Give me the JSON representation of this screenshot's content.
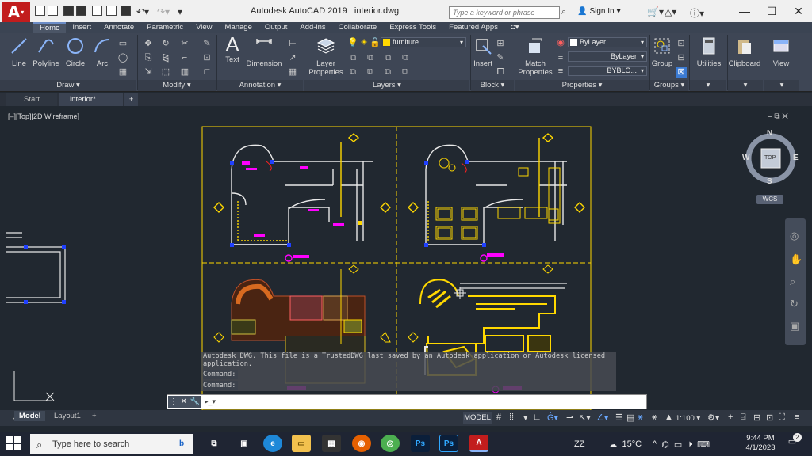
{
  "titlebar": {
    "app_name": "Autodesk AutoCAD 2019",
    "file_name": "interior.dwg",
    "search_placeholder": "Type a keyword or phrase",
    "sign_in": "Sign In",
    "logo_letter": "A"
  },
  "ribbon_tabs": [
    "Home",
    "Insert",
    "Annotate",
    "Parametric",
    "View",
    "Manage",
    "Output",
    "Add-ins",
    "Collaborate",
    "Express Tools",
    "Featured Apps"
  ],
  "active_tab": "Home",
  "ribbon": {
    "draw": {
      "title": "Draw ▾",
      "line": "Line",
      "polyline": "Polyline",
      "circle": "Circle",
      "arc": "Arc"
    },
    "modify": {
      "title": "Modify ▾"
    },
    "annotation": {
      "title": "Annotation ▾",
      "text": "Text",
      "dimension": "Dimension"
    },
    "layers": {
      "title": "Layers ▾",
      "layer_properties_1": "Layer",
      "layer_properties_2": "Properties",
      "current_layer": "furniture"
    },
    "block": {
      "title": "Block ▾",
      "insert": "Insert"
    },
    "properties": {
      "title": "Properties ▾",
      "match_1": "Match",
      "match_2": "Properties",
      "color": "ByLayer",
      "linetype": "ByLayer",
      "lineweight": "BYBLO..."
    },
    "groups": {
      "title": "Groups ▾",
      "group": "Group"
    },
    "utilities": "Utilities",
    "clipboard": "Clipboard",
    "view": "View"
  },
  "file_tabs": {
    "start": "Start",
    "active": "interior*"
  },
  "viewport": {
    "label": "[–][Top][2D Wireframe]",
    "controls": "–  ⧉  ✕",
    "viewcube": {
      "n": "N",
      "s": "S",
      "e": "E",
      "w": "W",
      "top": "TOP"
    },
    "wcs": "WCS"
  },
  "ucs": {
    "x": "X",
    "y": "Y"
  },
  "command": {
    "history": [
      "Autodesk DWG.  This file is a TrustedDWG last saved by an Autodesk application or Autodesk licensed",
      "application."
    ],
    "prompts": [
      "Command:",
      "Command:"
    ],
    "input_icon": "▸_▾"
  },
  "layout_tabs": [
    "Model",
    "Layout1"
  ],
  "status": {
    "model": "MODEL",
    "scale": "1:100 ▾"
  },
  "taskbar": {
    "search": "Type here to search",
    "weather": "15°C",
    "zz": "ZZ",
    "time": "9:44 PM",
    "date": "4/1/2023",
    "notifications": "2"
  },
  "colors": {
    "accent_red": "#c21d1d",
    "ribbon_bg": "#3e4655",
    "canvas_bg": "#212830",
    "drawing_yellow": "#ffd800",
    "drawing_magenta": "#ff00ff"
  }
}
